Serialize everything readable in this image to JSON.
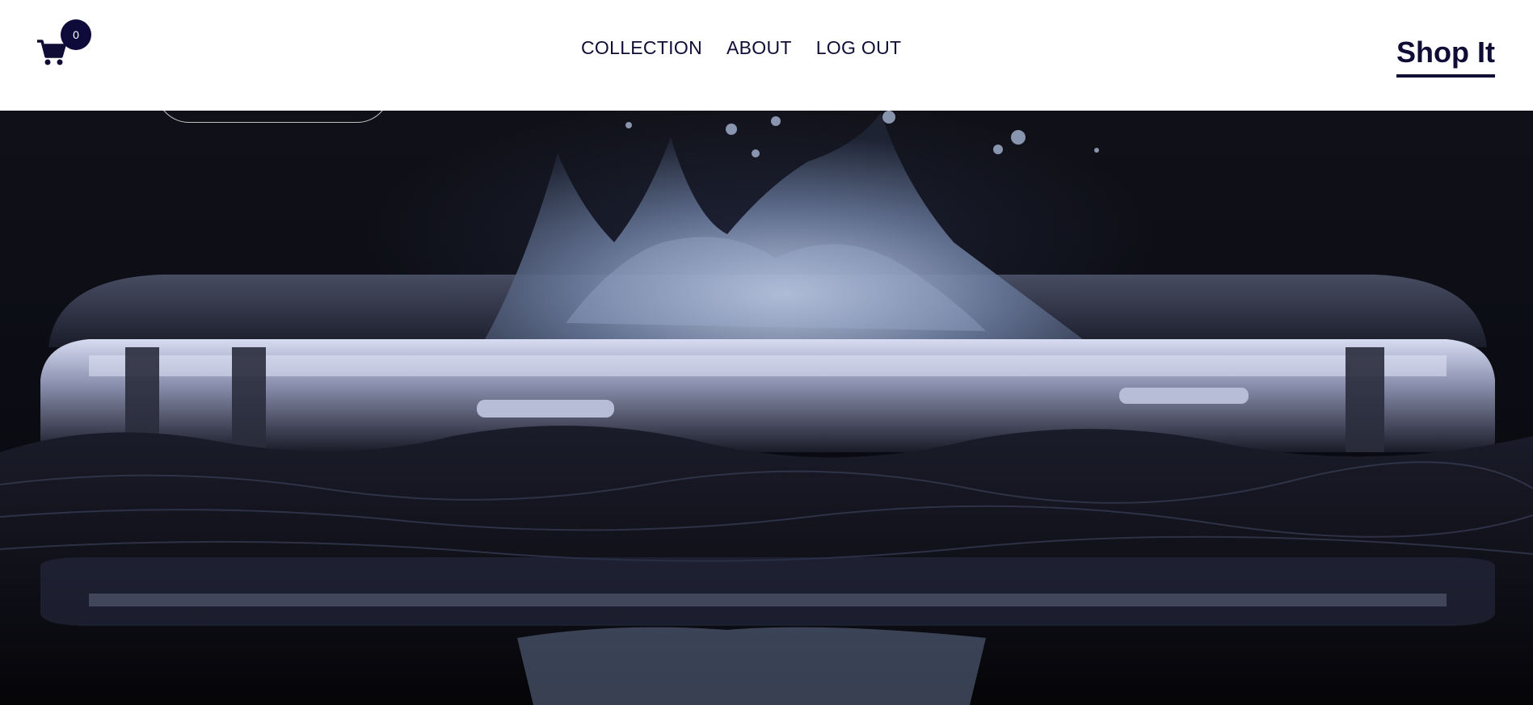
{
  "navbar": {
    "cart_icon": "shopping-cart-icon",
    "cart_count": "0",
    "links": [
      {
        "label": "COLLECTION"
      },
      {
        "label": "ABOUT"
      },
      {
        "label": "LOG OUT"
      }
    ],
    "brand": "Shop It"
  },
  "colors": {
    "brand_navy": "#0f0d36",
    "badge_bg": "#0e0b3b",
    "navbar_bg": "#ffffff",
    "hero_bg": "#0b0b12"
  }
}
